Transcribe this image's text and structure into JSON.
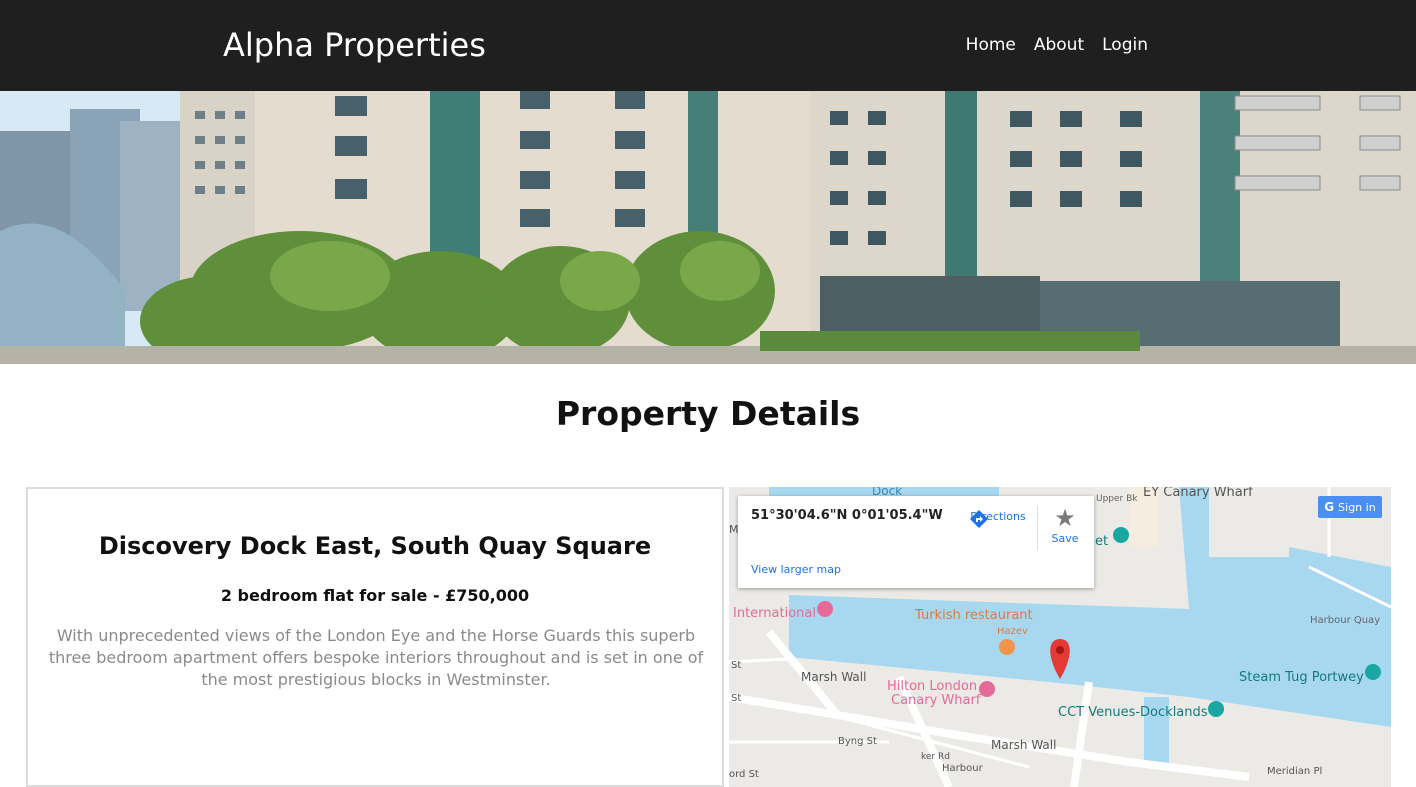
{
  "nav": {
    "brand": "Alpha Properties",
    "links": [
      "Home",
      "About",
      "Login"
    ]
  },
  "page_title": "Property Details",
  "property": {
    "title": "Discovery Dock East, South Quay Square",
    "price_line": "2 bedroom flat for sale - £750,000",
    "description": "With unprecedented views of the London Eye and the Horse Guards this superb three bedroom apartment offers bespoke interiors throughout and is set in one of the most prestigious blocks in Westminster."
  },
  "map": {
    "coords": "51°30'04.6\"N 0°01'05.4\"W",
    "directions_label": "Directions",
    "save_label": "Save",
    "larger_map_label": "View larger map",
    "sign_in_label": "Sign in",
    "sign_in_icon": "G",
    "places": [
      {
        "name": "EY Canary Wharf"
      },
      {
        "name": "International"
      },
      {
        "name": "Turkish restaurant"
      },
      {
        "name": "Hazev"
      },
      {
        "name": "Hilton London"
      },
      {
        "name": "Canary Wharf"
      },
      {
        "name": "Steam Tug Portwey"
      },
      {
        "name": "CCT Venues-Docklands"
      },
      {
        "name": "Harbour Quay"
      },
      {
        "name": "Marsh Wall"
      },
      {
        "name": "Marsh Wall"
      },
      {
        "name": "Byng St"
      },
      {
        "name": "Meridian Pl"
      },
      {
        "name": "Harbour"
      },
      {
        "name": "Marsh"
      },
      {
        "name": "Dock"
      },
      {
        "name": "et"
      },
      {
        "name": "Upper Bk"
      },
      {
        "name": "St"
      },
      {
        "name": "St"
      },
      {
        "name": "ord St"
      },
      {
        "name": "ker Rd"
      }
    ],
    "colors": {
      "water": "#a8d8f0",
      "land": "#eceae6",
      "pin": "#e53935",
      "link": "#1a73e8",
      "poi_pink": "#e56a9a",
      "poi_teal": "#1aa7a3",
      "poi_orange": "#f0954a"
    }
  },
  "colors": {
    "navbar_bg": "#1f1f1f",
    "desc_text": "#8a8a8a"
  }
}
